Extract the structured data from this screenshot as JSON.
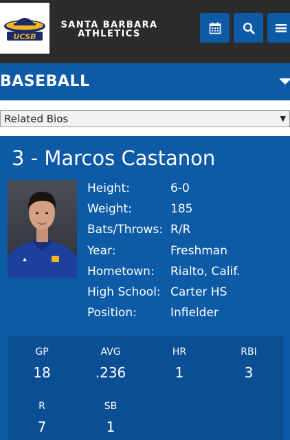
{
  "header": {
    "logo_text": "UCSB",
    "brand_line1": "SANTA BARBARA",
    "brand_line2": "ATHLETICS",
    "icons": [
      "calendar-icon",
      "search-icon",
      "menu-icon"
    ]
  },
  "sport": {
    "title": "BASEBALL"
  },
  "dropdown": {
    "selected": "Related Bios"
  },
  "player": {
    "name": "3 - Marcos Castanon",
    "bio": [
      {
        "label": "Height:",
        "value": "6-0"
      },
      {
        "label": "Weight:",
        "value": "185"
      },
      {
        "label": "Bats/Throws:",
        "value": "R/R"
      },
      {
        "label": "Year:",
        "value": "Freshman"
      },
      {
        "label": "Hometown:",
        "value": "Rialto, Calif."
      },
      {
        "label": "High School:",
        "value": "Carter HS"
      },
      {
        "label": "Position:",
        "value": "Infielder"
      }
    ]
  },
  "stats": [
    {
      "label": "GP",
      "value": "18"
    },
    {
      "label": "AVG",
      "value": ".236"
    },
    {
      "label": "HR",
      "value": "1"
    },
    {
      "label": "RBI",
      "value": "3"
    },
    {
      "label": "R",
      "value": "7"
    },
    {
      "label": "SB",
      "value": "1"
    }
  ],
  "colors": {
    "primary": "#0d5aa7",
    "stats_bg": "#0a4e94",
    "header_bg": "#2b2b2b",
    "logo_gold": "#f3b61a",
    "logo_navy": "#1b2a6b"
  }
}
